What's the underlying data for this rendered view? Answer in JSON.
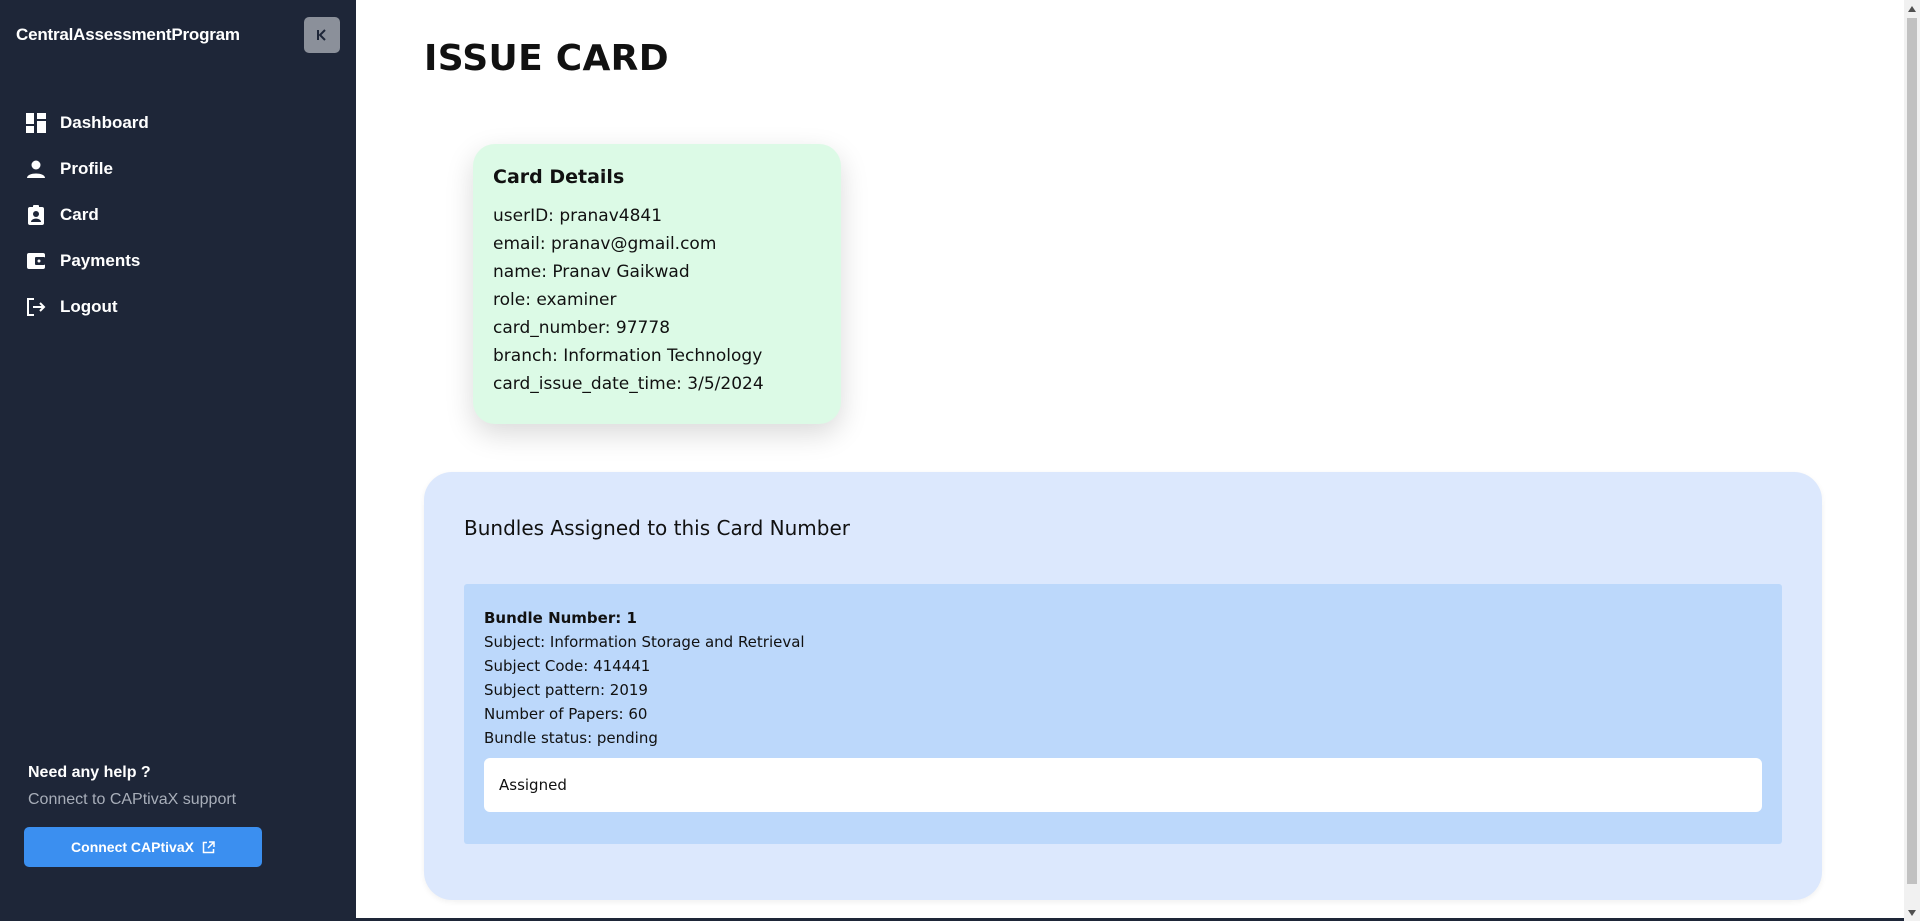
{
  "app": {
    "title": "CentralAssessmentProgram"
  },
  "sidebar": {
    "items": [
      {
        "label": "Dashboard",
        "icon": "dashboard-icon"
      },
      {
        "label": "Profile",
        "icon": "person-icon"
      },
      {
        "label": "Card",
        "icon": "badge-icon"
      },
      {
        "label": "Payments",
        "icon": "wallet-icon"
      },
      {
        "label": "Logout",
        "icon": "logout-icon"
      }
    ],
    "help_title": "Need any help ?",
    "help_subtitle": "Connect to CAPtivaX support",
    "connect_label": "Connect CAPtivaX"
  },
  "page": {
    "title": "ISSUE CARD"
  },
  "card": {
    "title": "Card Details",
    "lines": [
      "userID: pranav4841",
      "email: pranav@gmail.com",
      "name: Pranav Gaikwad",
      "role: examiner",
      "card_number: 97778",
      "branch: Information Technology",
      "card_issue_date_time: 3/5/2024"
    ]
  },
  "bundles": {
    "heading": "Bundles Assigned to this Card Number",
    "items": [
      {
        "number_label": "Bundle Number: 1",
        "subject": "Subject: Information Storage and Retrieval",
        "code": "Subject Code: 414441",
        "pattern": "Subject pattern: 2019",
        "papers": "Number of Papers: 60",
        "status": "Bundle status: pending",
        "assigned_text": "Assigned"
      }
    ]
  },
  "colors": {
    "sidebar_bg": "#1e2638",
    "card_bg": "#dcfae6",
    "panel_bg": "#dce8fd",
    "bundle_bg": "#bcd8fb",
    "accent": "#3b8ff0"
  }
}
